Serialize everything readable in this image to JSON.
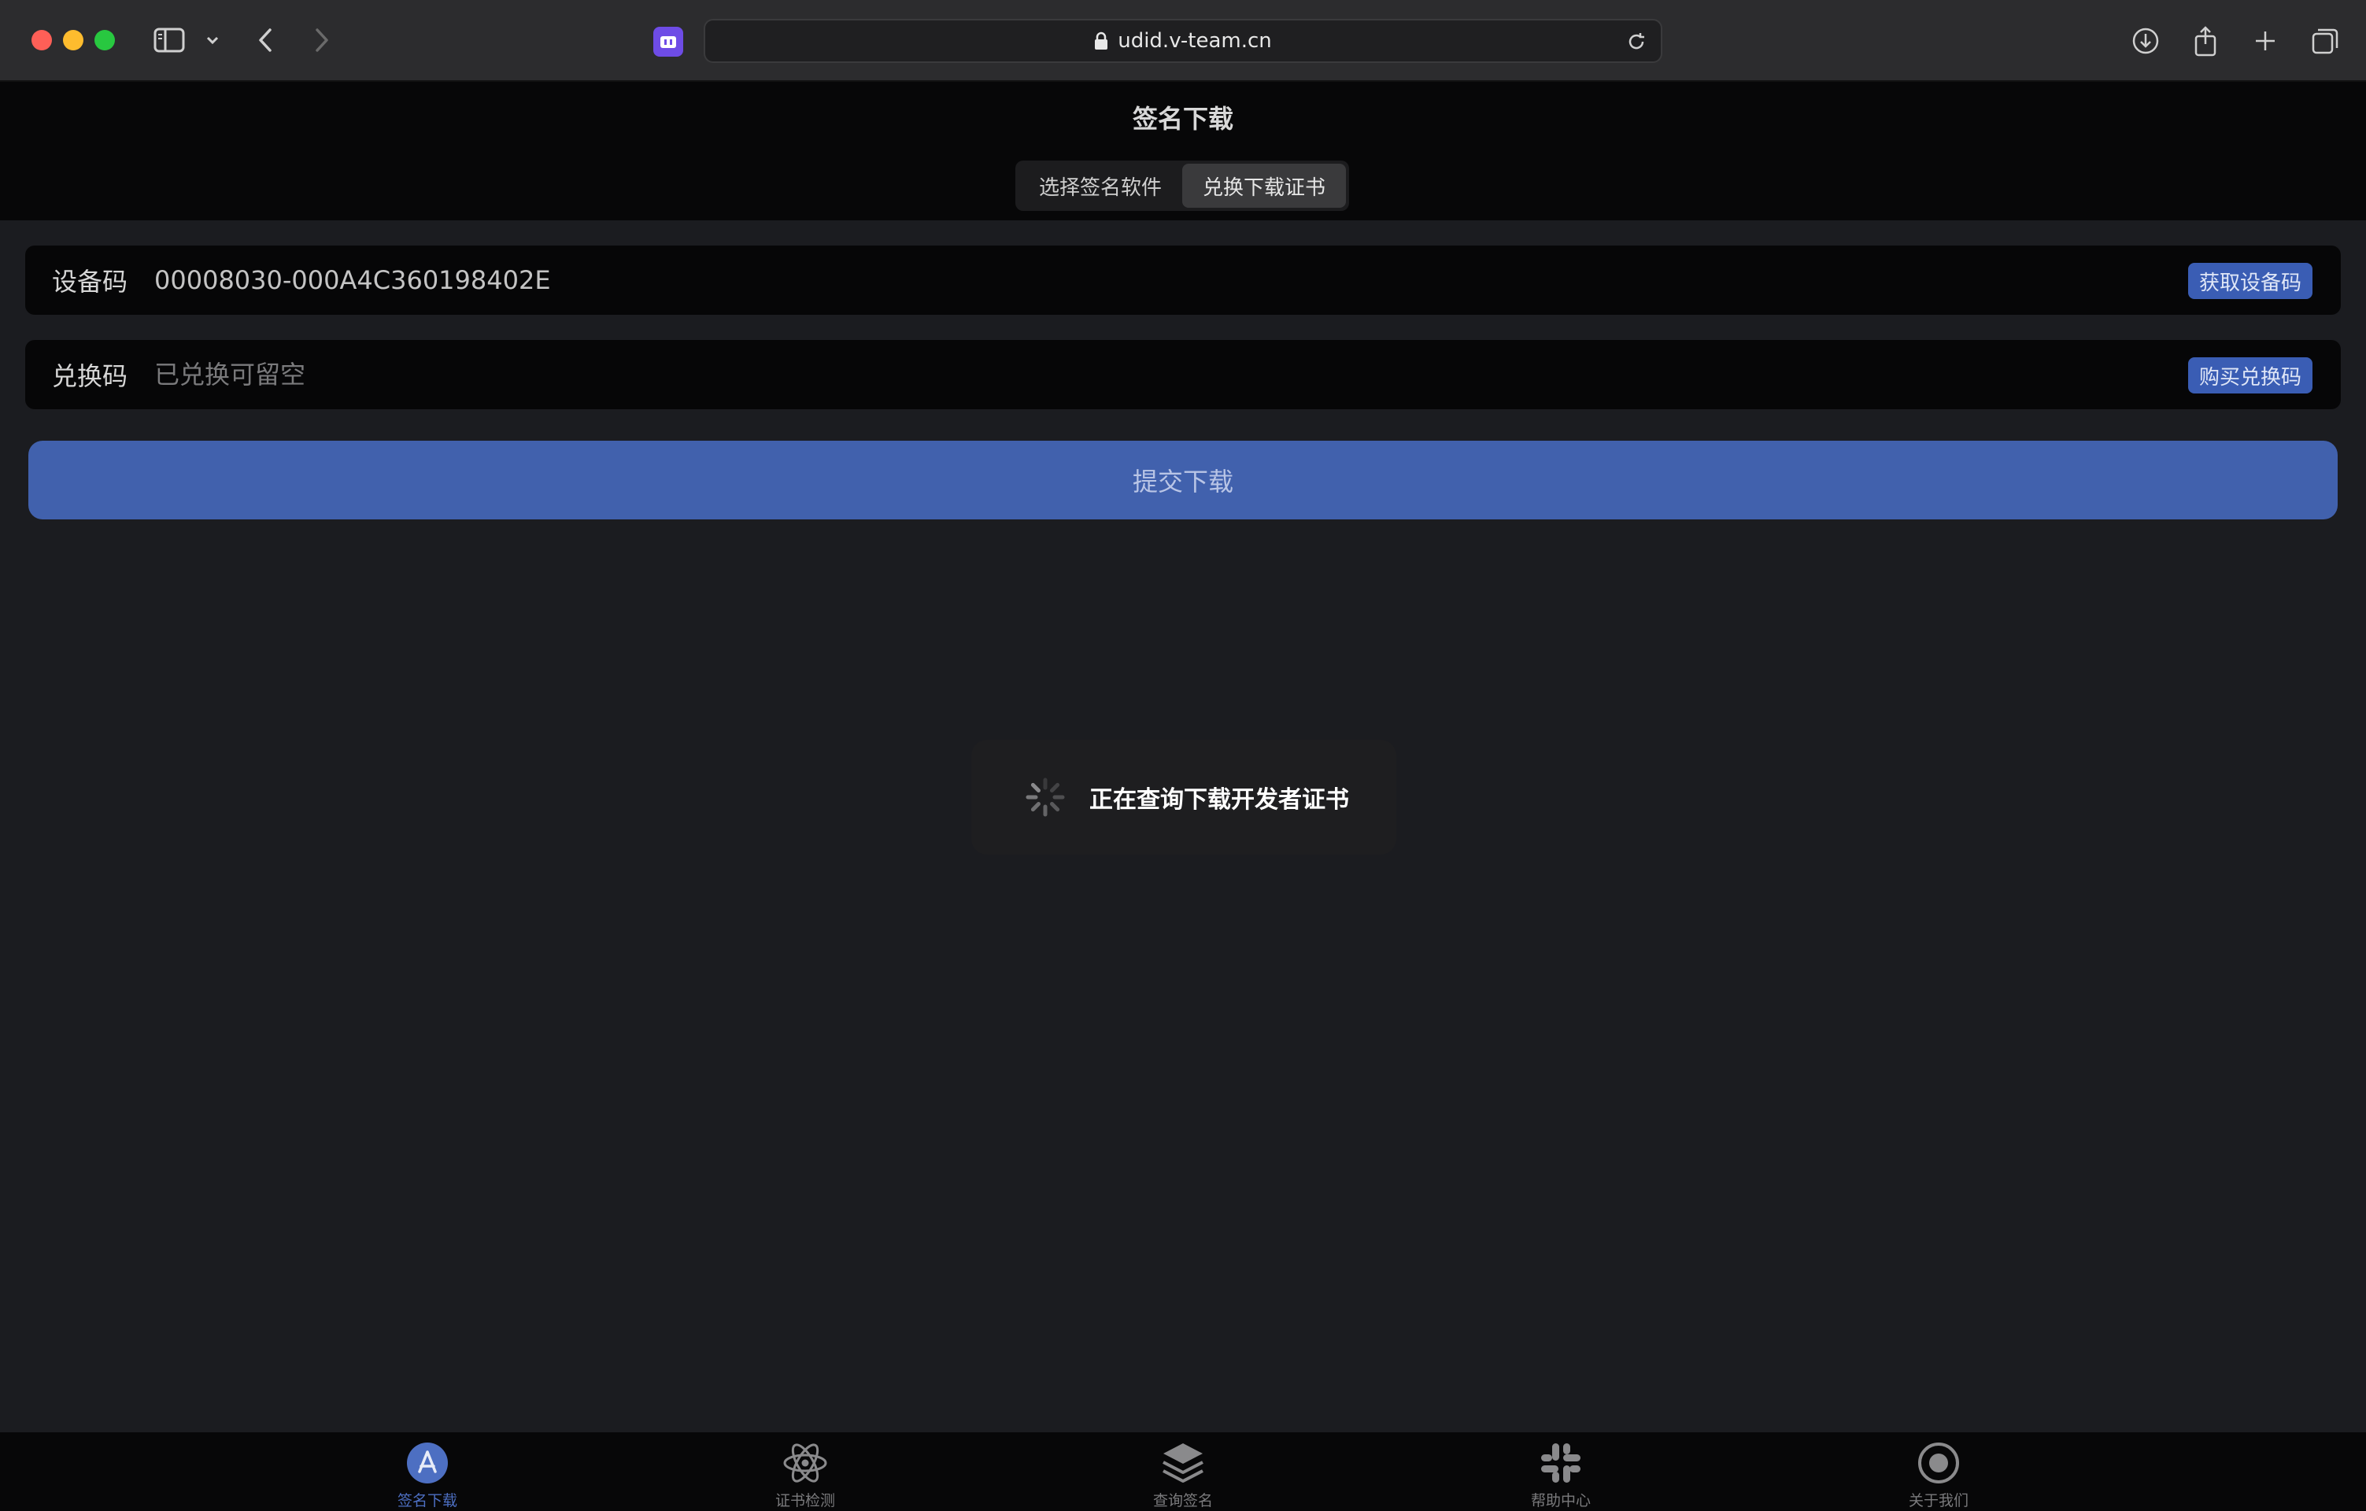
{
  "browser": {
    "url": "udid.v-team.cn"
  },
  "header": {
    "title": "签名下载",
    "tabs": [
      {
        "label": "选择签名软件",
        "active": false
      },
      {
        "label": "兑换下载证书",
        "active": true
      }
    ]
  },
  "form": {
    "device": {
      "label": "设备码",
      "value": "00008030-000A4C360198402E",
      "button": "获取设备码"
    },
    "code": {
      "label": "兑换码",
      "value": "",
      "placeholder": "已兑换可留空",
      "button": "购买兑换码"
    },
    "submit_label": "提交下载"
  },
  "toast": {
    "message": "正在查询下载开发者证书"
  },
  "tabbar": {
    "items": [
      {
        "label": "签名下载",
        "icon": "app-store-icon",
        "active": true
      },
      {
        "label": "证书检测",
        "icon": "atom-icon",
        "active": false
      },
      {
        "label": "查询签名",
        "icon": "layers-icon",
        "active": false
      },
      {
        "label": "帮助中心",
        "icon": "slack-icon",
        "active": false
      },
      {
        "label": "关于我们",
        "icon": "target-icon",
        "active": false
      }
    ]
  },
  "colors": {
    "accent": "#4161ad",
    "tab_active": "#4d6fc2"
  }
}
